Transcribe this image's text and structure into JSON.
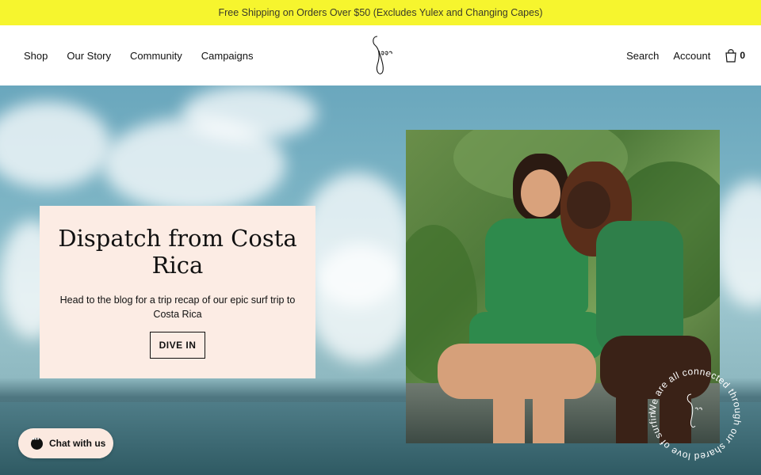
{
  "announcement": {
    "text": "Free Shipping on Orders Over $50 (Excludes Yulex and Changing Capes)"
  },
  "nav": {
    "left": [
      "Shop",
      "Our Story",
      "Community",
      "Campaigns"
    ],
    "search": "Search",
    "account": "Account",
    "cart_count": "0"
  },
  "logo": {
    "text": "Seea"
  },
  "hero": {
    "title": "Dispatch from Costa Rica",
    "description": "Head to the blog for a trip recap of our epic surf trip to Costa Rica",
    "cta": "DIVE IN"
  },
  "badge": {
    "text": "We are all connected through our shared love of surfing..."
  },
  "chat": {
    "label": "Chat with us"
  },
  "colors": {
    "announcement_bg": "#f6f52e",
    "card_bg": "#fcece4",
    "chat_bg": "#fbe9e0"
  }
}
